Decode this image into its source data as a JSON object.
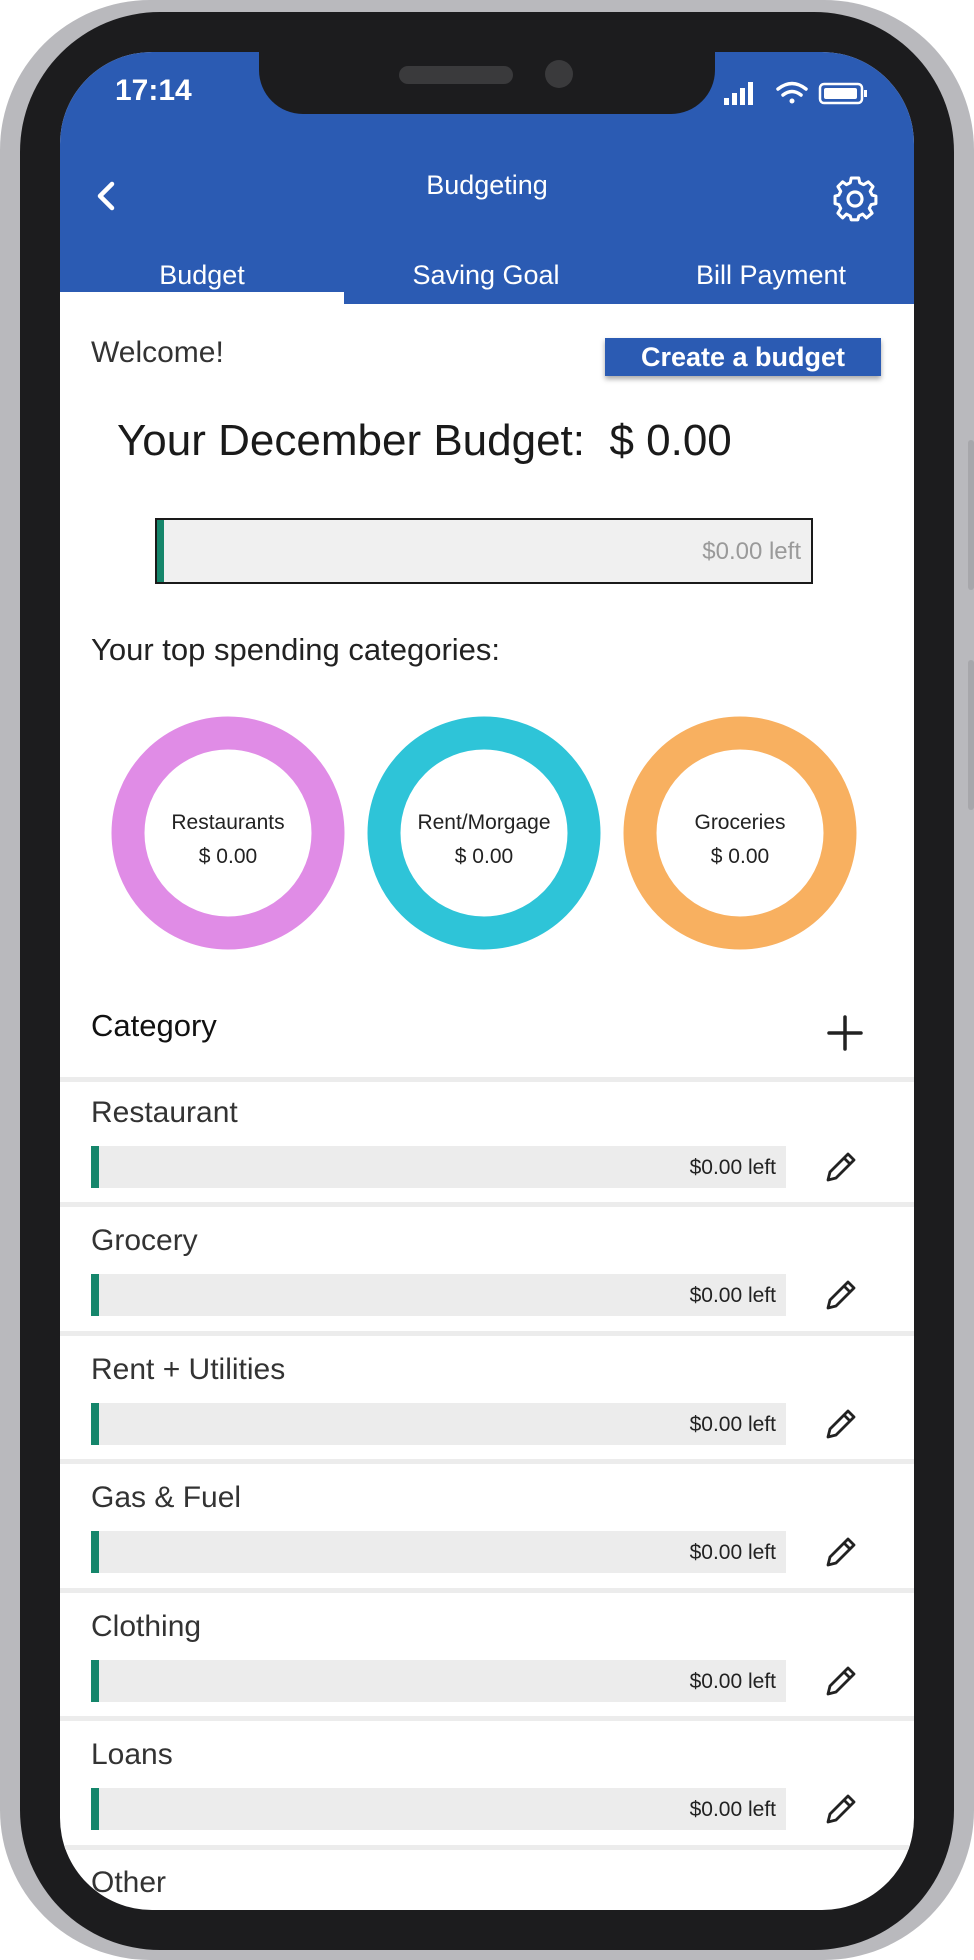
{
  "status_bar": {
    "time": "17:14",
    "signal_icon": "signal-icon",
    "wifi_icon": "wifi-icon",
    "battery_icon": "battery-icon"
  },
  "header": {
    "title": "Budgeting",
    "back_icon": "chevron-left-icon",
    "settings_icon": "gear-icon",
    "background_color": "#2b5bb3"
  },
  "tabs": [
    {
      "label": "Budget",
      "active": true
    },
    {
      "label": "Saving Goal",
      "active": false
    },
    {
      "label": "Bill Payment",
      "active": false
    }
  ],
  "welcome_text": "Welcome!",
  "create_button_label": "Create a budget",
  "budget": {
    "title": "Your December Budget:  $ 0.00",
    "remaining_label": "$0.00 left",
    "progress_fraction": 0.01
  },
  "top_categories_label": "Your top spending categories:",
  "top_categories": [
    {
      "name": "Restaurants",
      "amount": "$ 0.00",
      "color": "#e08ce6"
    },
    {
      "name": "Rent/Morgage",
      "amount": "$ 0.00",
      "color": "#2ec4d8"
    },
    {
      "name": "Groceries",
      "amount": "$ 0.00",
      "color": "#f8b060"
    }
  ],
  "category_section": {
    "heading": "Category",
    "add_icon": "plus-icon"
  },
  "categories": [
    {
      "name": "Restaurant",
      "remaining": "$0.00 left",
      "progress_fraction": 0.012
    },
    {
      "name": "Grocery",
      "remaining": "$0.00 left",
      "progress_fraction": 0.012
    },
    {
      "name": "Rent + Utilities",
      "remaining": "$0.00 left",
      "progress_fraction": 0.012
    },
    {
      "name": "Gas & Fuel",
      "remaining": "$0.00 left",
      "progress_fraction": 0.012
    },
    {
      "name": "Clothing",
      "remaining": "$0.00 left",
      "progress_fraction": 0.012
    },
    {
      "name": "Loans",
      "remaining": "$0.00 left",
      "progress_fraction": 0.012
    },
    {
      "name": "Other",
      "remaining": "",
      "progress_fraction": 0.012
    }
  ],
  "edit_icon": "pencil-icon",
  "accent_color": "#15866b"
}
